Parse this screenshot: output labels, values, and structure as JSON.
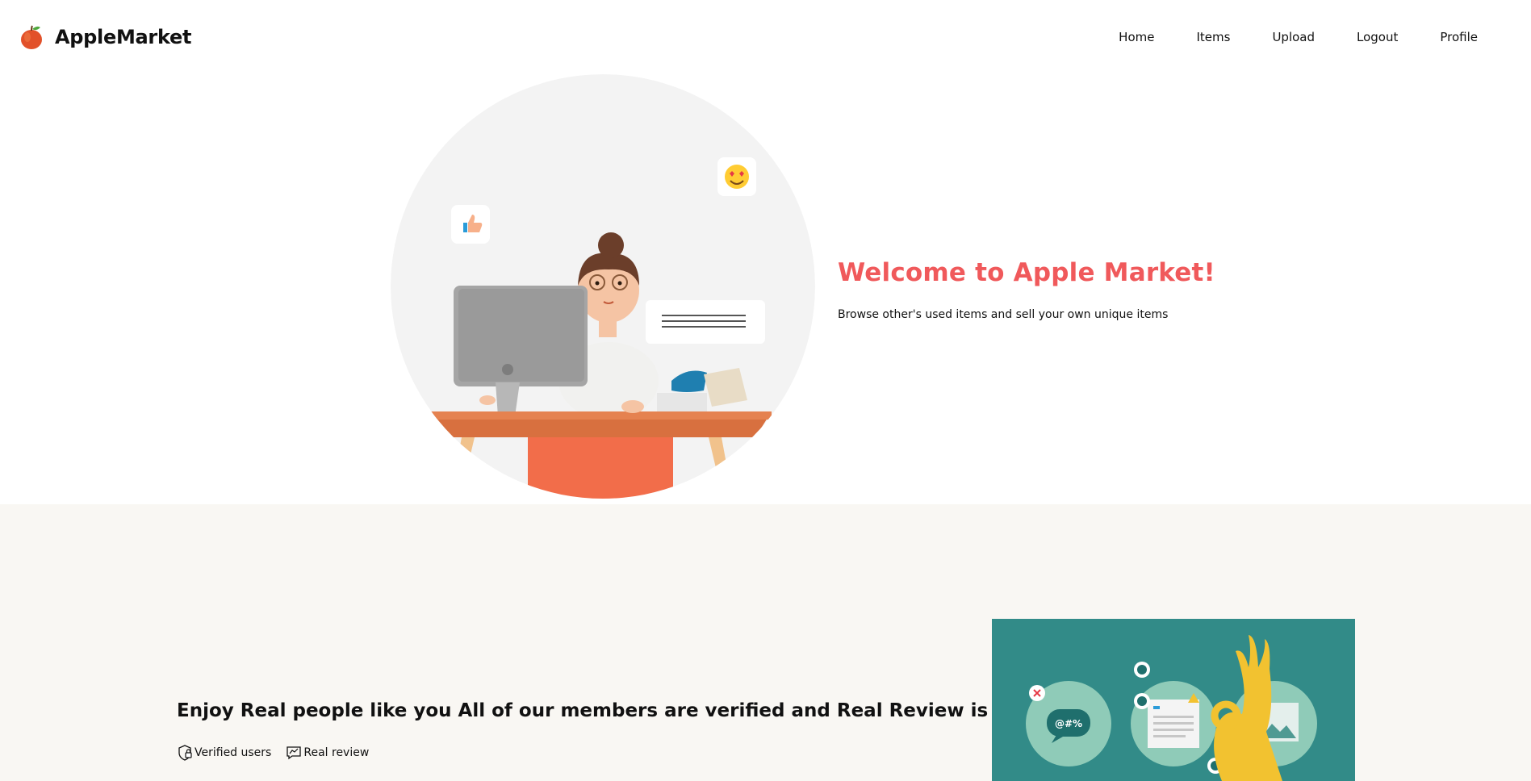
{
  "brand": {
    "name": "AppleMarket",
    "logo_icon": "apple-icon"
  },
  "nav": {
    "items": [
      {
        "label": "Home"
      },
      {
        "label": "Items"
      },
      {
        "label": "Upload"
      },
      {
        "label": "Logout"
      },
      {
        "label": "Profile"
      }
    ]
  },
  "hero": {
    "title": "Welcome to Apple Market!",
    "subtitle": "Browse other's used items and sell your own unique items",
    "illustration_icon": "woman-at-computer-illustration",
    "title_color": "#f0595b"
  },
  "feature": {
    "heading": "Enjoy Real people like you All of our members are verified and Real Review is there for you",
    "badges": [
      {
        "label": "Verified users",
        "icon": "shield-lock-icon"
      },
      {
        "label": "Real review",
        "icon": "review-icon"
      }
    ],
    "illustration_icon": "social-feedback-illustration",
    "art_background": "#328b88",
    "section_background": "#f9f7f3"
  }
}
